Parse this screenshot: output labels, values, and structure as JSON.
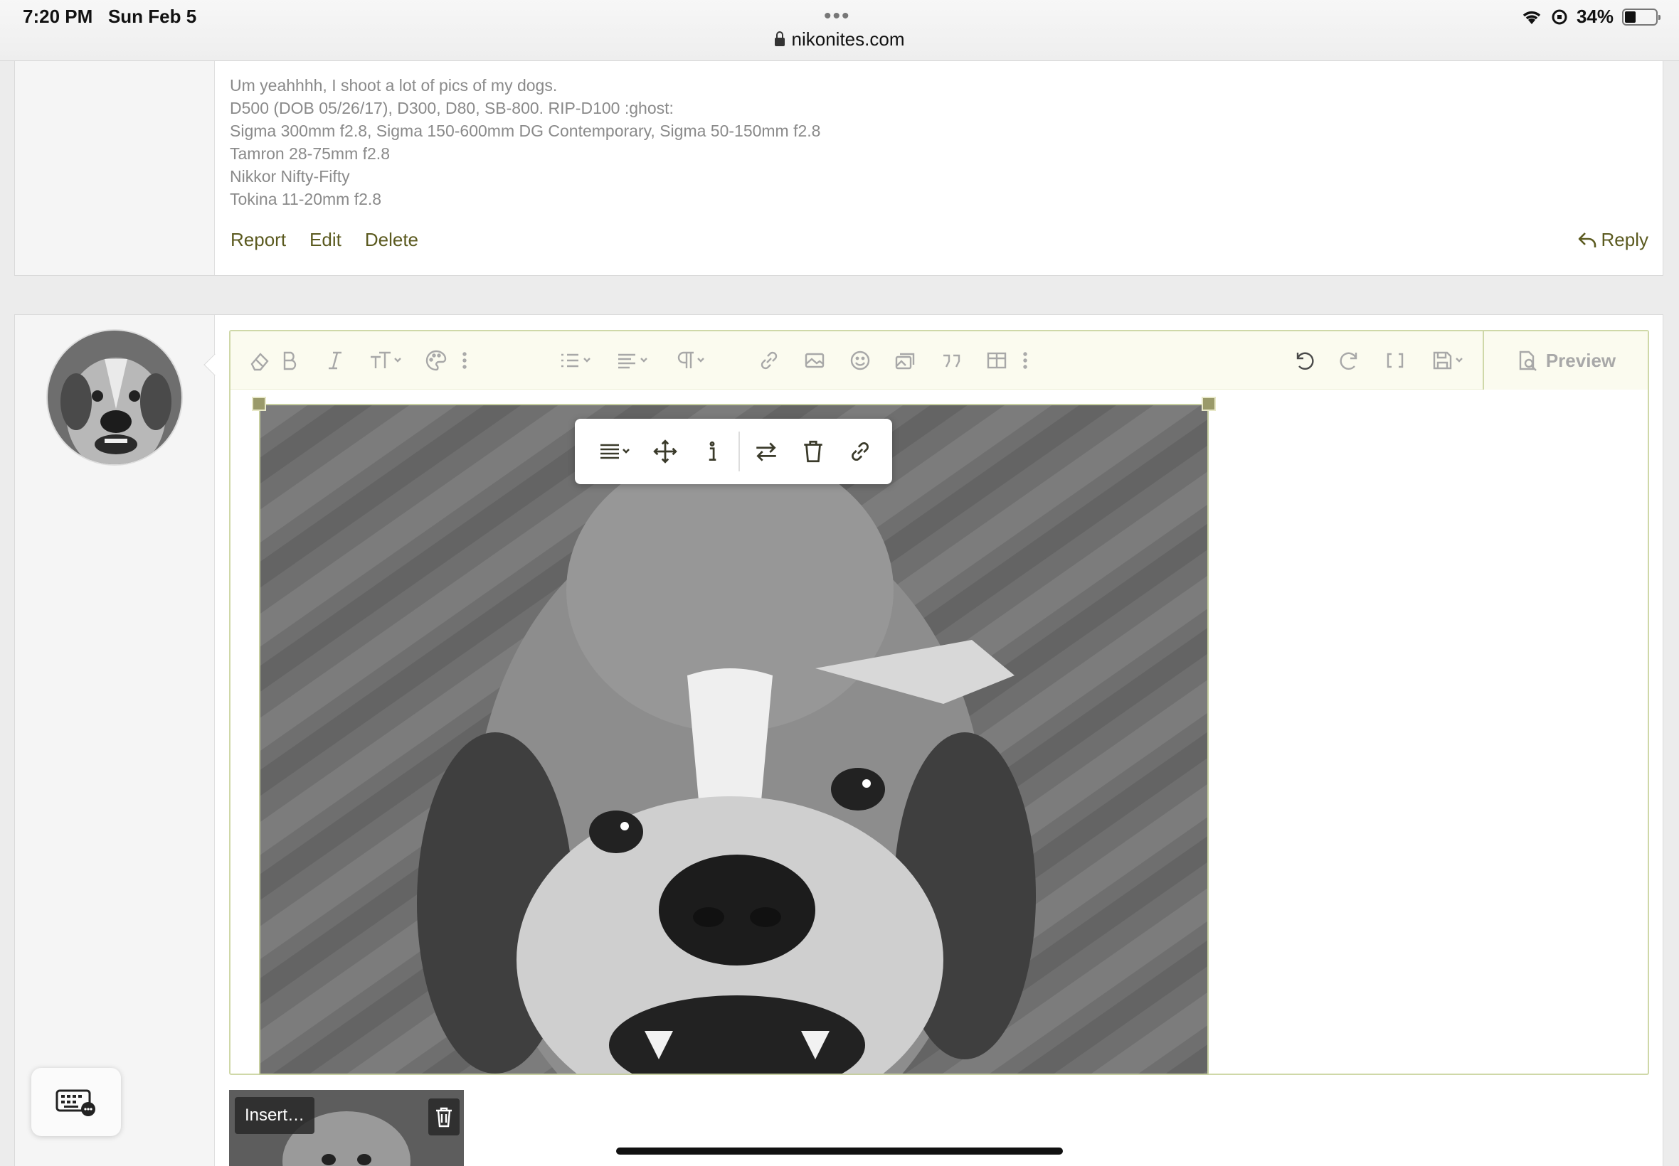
{
  "status_bar": {
    "time": "7:20 PM",
    "date": "Sun Feb 5",
    "url": "nikonites.com",
    "battery": "34%"
  },
  "post": {
    "signature_lines": [
      "Um yeahhhh, I shoot a lot of pics of my dogs.",
      "D500 (DOB 05/26/17), D300, D80, SB-800. RIP-D100 :ghost:",
      "Sigma 300mm f2.8, Sigma 150-600mm DG Contemporary, Sigma 50-150mm f2.8",
      "Tamron 28-75mm f2.8",
      "Nikkor Nifty-Fifty",
      "Tokina 11-20mm f2.8"
    ],
    "actions": {
      "report": "Report",
      "edit": "Edit",
      "delete": "Delete",
      "reply": "Reply"
    }
  },
  "editor": {
    "preview_label": "Preview",
    "toolbar_icons": [
      "eraser-icon",
      "bold-icon",
      "italic-icon",
      "text-size-icon",
      "palette-icon",
      "more-icon",
      "list-icon",
      "align-icon",
      "paragraph-icon",
      "link-icon",
      "image-icon",
      "smiley-icon",
      "gallery-icon",
      "quote-icon",
      "table-icon",
      "more-icon",
      "undo-icon",
      "redo-icon",
      "bbcode-icon",
      "save-icon"
    ],
    "image_popup_icons": [
      "align-icon",
      "move-icon",
      "alt-text-icon",
      "replace-icon",
      "trash-icon",
      "link-icon"
    ]
  },
  "attachment": {
    "insert_label": "Insert…"
  },
  "colors": {
    "accent": "#5b5a1f",
    "editor_border": "#cfd8a8",
    "toolbar_bg": "#fbfbef"
  }
}
